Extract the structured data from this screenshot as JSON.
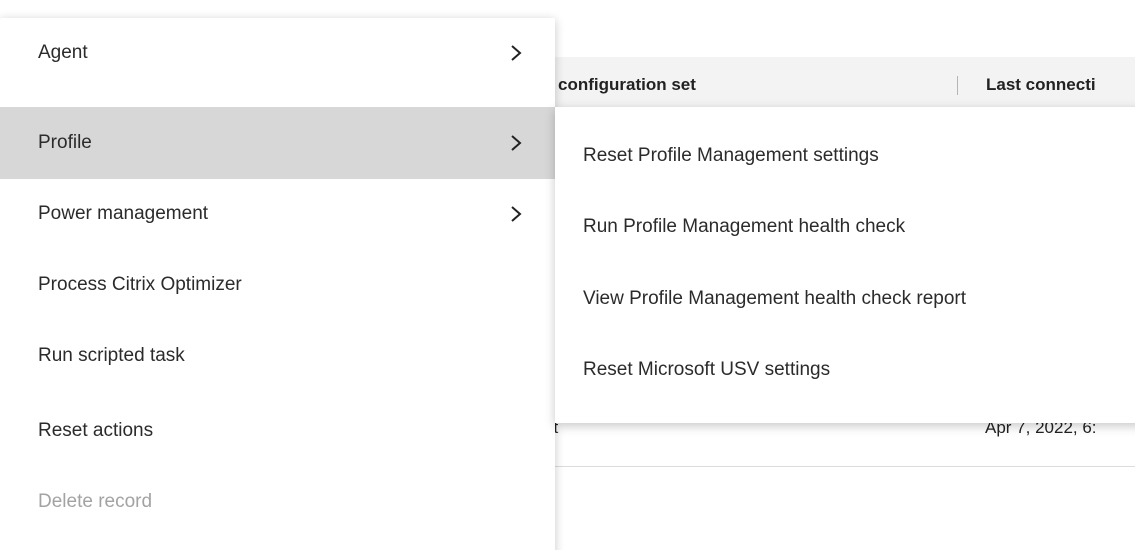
{
  "table": {
    "headers": [
      "configuration set",
      "Last connecti"
    ],
    "row": [
      "st",
      "Apr 7, 2022, 6:"
    ]
  },
  "menu": {
    "items": [
      {
        "label": "Agent",
        "has_submenu": true,
        "state": "normal"
      },
      {
        "label": "Profile",
        "has_submenu": true,
        "state": "active"
      },
      {
        "label": "Power management",
        "has_submenu": true,
        "state": "normal"
      },
      {
        "label": "Process Citrix Optimizer",
        "has_submenu": false,
        "state": "normal"
      },
      {
        "label": "Run scripted task",
        "has_submenu": false,
        "state": "normal"
      },
      {
        "label": "Reset actions",
        "has_submenu": false,
        "state": "normal"
      },
      {
        "label": "Delete record",
        "has_submenu": false,
        "state": "disabled"
      }
    ]
  },
  "submenu": {
    "items": [
      {
        "label": "Reset Profile Management settings"
      },
      {
        "label": "Run Profile Management health check"
      },
      {
        "label": "View Profile Management health check report"
      },
      {
        "label": "Reset Microsoft USV settings"
      }
    ]
  },
  "colors": {
    "active_item_bg": "#d7d7d7",
    "text": "#2b2b2b",
    "disabled_text": "#a3a3a3",
    "header_bg": "#f3f3f3"
  },
  "icons": {
    "submenu_indicator": "chevron-right-icon"
  }
}
